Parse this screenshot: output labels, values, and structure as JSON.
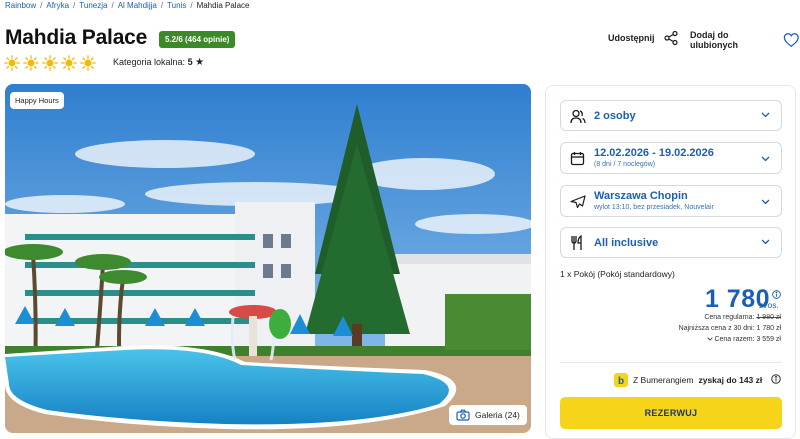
{
  "breadcrumb": {
    "items": [
      "Rainbow",
      "Afryka",
      "Tunezja",
      "Al Mahdijja",
      "Tunis"
    ],
    "current": "Mahdia Palace"
  },
  "hotel": {
    "name": "Mahdia Palace",
    "rating": "5.2/6 (464 opinie)",
    "sun_count": 5,
    "local_category_label": "Kategoria lokalna:",
    "local_category_value": "5",
    "star_glyph": "★"
  },
  "actions": {
    "share_label": "Udostępnij",
    "favorite_label": "Dodaj do ulubionych"
  },
  "gallery": {
    "badge": "Happy Hours",
    "button_label": "Galeria (24)"
  },
  "booking": {
    "guests": "2 osoby",
    "dates": "12.02.2026 - 19.02.2026",
    "dates_sub": "(8 dni / 7 noclegów)",
    "airport": "Warszawa Chopin",
    "airport_sub": "wylot 13:10, bez przesiadek, Nouvelair",
    "board": "All inclusive",
    "room": "1 x Pokój  (Pokój standardowy)",
    "price": "1 780",
    "price_unit": "zł/os.",
    "regular_label": "Cena regularna:",
    "regular_value": "1 980 zł",
    "lowest_label": "Najniższa cena z 30 dni: 1 780 zł",
    "total_label": "Cena razem: 3 559 zł",
    "boomerang_prefix": "Z Bumerangiem",
    "boomerang_bold": "zyskaj do 143 zł",
    "reserve_label": "REZERWUJ"
  },
  "colors": {
    "brand_blue": "#1a5fb4",
    "rating_green": "#3a8a27",
    "reserve_yellow": "#f5d419",
    "sun_yellow": "#f6b800"
  }
}
